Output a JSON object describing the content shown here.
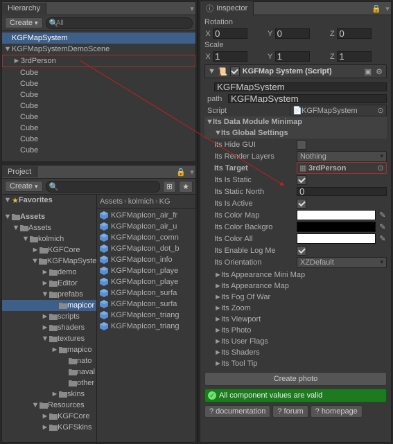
{
  "hierarchy": {
    "title": "Hierarchy",
    "create": "Create",
    "searchScope": "All",
    "items": [
      {
        "label": "KGFMapSystem",
        "depth": 0,
        "sel": true
      },
      {
        "label": "KGFMapSystemDemoScene",
        "depth": 0,
        "exp": "▼"
      },
      {
        "label": "3rdPerson",
        "depth": 1,
        "exp": "►",
        "box": true
      },
      {
        "label": "Cube",
        "depth": 1
      },
      {
        "label": "Cube",
        "depth": 1
      },
      {
        "label": "Cube",
        "depth": 1
      },
      {
        "label": "Cube",
        "depth": 1
      },
      {
        "label": "Cube",
        "depth": 1
      },
      {
        "label": "Cube",
        "depth": 1
      },
      {
        "label": "Cube",
        "depth": 1
      },
      {
        "label": "Cube",
        "depth": 1
      }
    ]
  },
  "project": {
    "title": "Project",
    "create": "Create",
    "favorites": "Favorites",
    "assetsHeader": "Assets",
    "breadcrumb": [
      "Assets",
      "kolmich",
      "KG"
    ],
    "folders": [
      {
        "l": "Assets",
        "d": 0,
        "e": "▼"
      },
      {
        "l": "kolmich",
        "d": 1,
        "e": "▼"
      },
      {
        "l": "KGFCore",
        "d": 2,
        "e": "►"
      },
      {
        "l": "KGFMapSyste",
        "d": 2,
        "e": "▼"
      },
      {
        "l": "demo",
        "d": 3,
        "e": "►"
      },
      {
        "l": "Editor",
        "d": 3,
        "e": "►"
      },
      {
        "l": "prefabs",
        "d": 3,
        "e": "▼"
      },
      {
        "l": "mapicor",
        "d": 4,
        "sel": true
      },
      {
        "l": "scripts",
        "d": 3,
        "e": "►"
      },
      {
        "l": "shaders",
        "d": 3,
        "e": "►"
      },
      {
        "l": "textures",
        "d": 3,
        "e": "▼"
      },
      {
        "l": "mapico",
        "d": 4,
        "e": "►"
      },
      {
        "l": "nato",
        "d": 5
      },
      {
        "l": "naval",
        "d": 5
      },
      {
        "l": "other",
        "d": 5
      },
      {
        "l": "skins",
        "d": 4,
        "e": "►"
      },
      {
        "l": "Resources",
        "d": 2,
        "e": "▼"
      },
      {
        "l": "KGFCore",
        "d": 3,
        "e": "►"
      },
      {
        "l": "KGFSkins",
        "d": 3,
        "e": "►"
      }
    ],
    "assets": [
      "KGFMapIcon_air_fr",
      "KGFMapIcon_air_u",
      "KGFMapIcon_comn",
      "KGFMapIcon_dot_b",
      "KGFMapIcon_info",
      "KGFMapIcon_playe",
      "KGFMapIcon_playe",
      "KGFMapIcon_surfa",
      "KGFMapIcon_surfa",
      "KGFMapIcon_triang",
      "KGFMapIcon_triang"
    ]
  },
  "inspector": {
    "title": "Inspector",
    "rotation": {
      "label": "Rotation",
      "x": "0",
      "y": "0",
      "z": "0"
    },
    "scale": {
      "label": "Scale",
      "x": "1",
      "y": "1",
      "z": "1"
    },
    "component": {
      "title": "KGFMap System (Script)"
    },
    "nameField": "KGFMapSystem",
    "pathLabel": "path",
    "pathValue": "KGFMapSystem",
    "scriptLabel": "Script",
    "scriptValue": "KGFMapSystem",
    "sec1": "Its Data Module Minimap",
    "sec2": "Its Global Settings",
    "fields": {
      "hideGui": "Its Hide GUI",
      "renderLayers": "Its Render Layers",
      "renderLayersVal": "Nothing",
      "target": "Its Target",
      "targetVal": "3rdPerson",
      "isStatic": "Its Is Static",
      "staticNorth": "Its Static North",
      "staticNorthVal": "0",
      "isActive": "Its Is Active",
      "colorMap": "Its Color Map",
      "colorMapVal": "#ffffff",
      "colorBg": "Its Color Backgro",
      "colorBgVal": "#000000",
      "colorAll": "Its Color All",
      "colorAllVal": "#ffffff",
      "enableLog": "Its Enable Log Me",
      "orientation": "Its Orientation",
      "orientationVal": "XZDefault"
    },
    "folds": [
      "Its Appearance Mini Map",
      "Its Appearance Map",
      "Its Fog Of War",
      "Its Zoom",
      "Its Viewport",
      "Its Photo",
      "Its User Flags",
      "Its Shaders",
      "Its Tool Tip"
    ],
    "createPhoto": "Create photo",
    "valid": "All component values are valid",
    "help": {
      "doc": "? documentation",
      "forum": "? forum",
      "home": "? homepage"
    }
  }
}
